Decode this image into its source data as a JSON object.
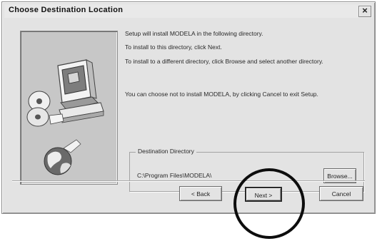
{
  "window": {
    "title": "Choose Destination Location",
    "close_glyph": "×",
    "close_icon": "close-icon"
  },
  "content": {
    "line1": "Setup will install MODELA in the following directory.",
    "line2": "To install to this directory, click Next.",
    "line3": "To install to a different directory, click Browse and select another directory.",
    "line4": "You can choose not to install MODELA, by clicking Cancel to exit Setup."
  },
  "destination": {
    "group_label": "Destination Directory",
    "path": "C:\\Program Files\\MODELA\\",
    "browse_label": "Browse..."
  },
  "buttons": {
    "back_label": "< Back",
    "next_label": "Next >",
    "cancel_label": "Cancel"
  },
  "illustration": {
    "icons": [
      "computer-icon",
      "cd-disc-icon",
      "globe-icon"
    ]
  },
  "colors": {
    "dialog_face": "#e3e3e3",
    "illustration_panel": "#c7c7c7",
    "highlight_ring": "#0d0d0d"
  }
}
